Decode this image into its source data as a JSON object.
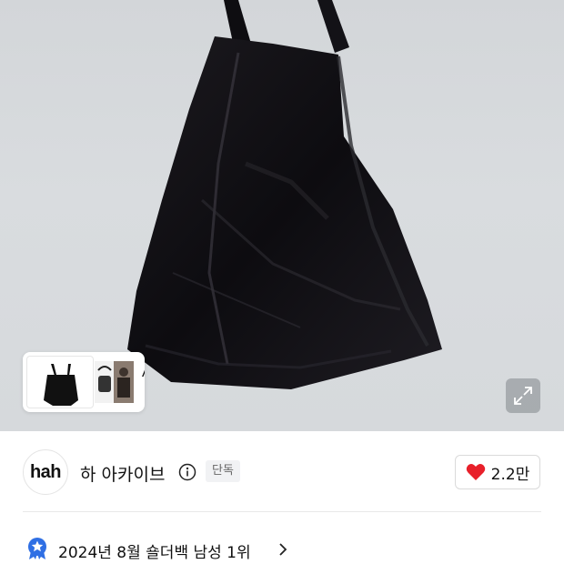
{
  "product_image": {
    "alt_icon": "shoulder-bag-photo"
  },
  "ai_recommend": {
    "label": "AI",
    "icon": "chevron-right-icon"
  },
  "expand_button": {
    "icon": "expand-icon"
  },
  "brand": {
    "logo_text": "hah",
    "name": "하 아카이브",
    "info_icon": "info-icon",
    "badge": "단독"
  },
  "like": {
    "icon": "heart-icon",
    "count": "2.2만",
    "color": "#e8202a"
  },
  "ranking": {
    "icon": "ranking-medal-icon",
    "text": "2024년 8월 숄더백 남성 1위",
    "badge_color": "#2f6fe4"
  }
}
